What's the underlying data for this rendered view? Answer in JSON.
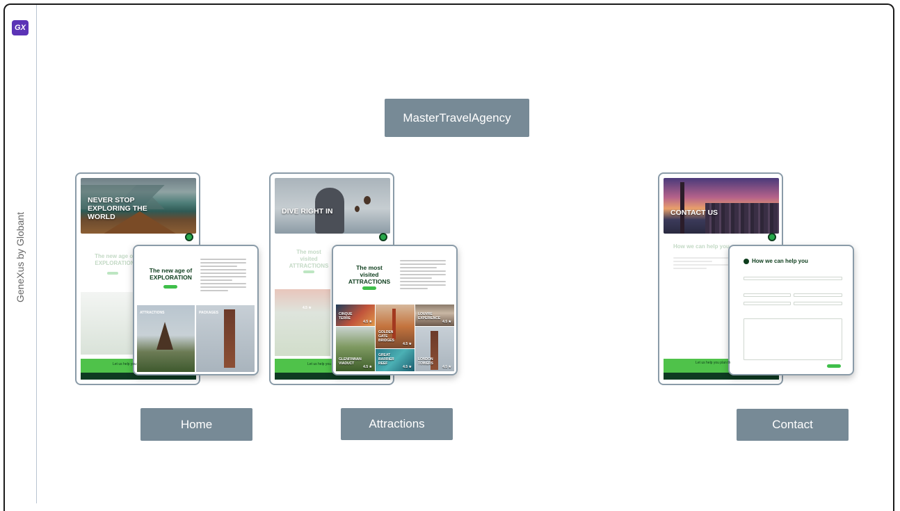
{
  "brand": {
    "logo_text": "GX",
    "vertical_text": "GeneXus by Globant"
  },
  "root": {
    "label": "MasterTravelAgency"
  },
  "pages": [
    {
      "label": "Home",
      "hero_title": "NEVER STOP EXPLORING THE WORLD",
      "faded_heading": "The new age of EXPLORATION",
      "phone_heading_line1": "The new age of",
      "phone_heading_line2": "EXPLORATION",
      "tile1_title": "ATTRACTIONS",
      "tile2_title": "PACKAGES",
      "cta": "Let us help you"
    },
    {
      "label": "Attractions",
      "hero_title": "DIVE RIGHT IN",
      "faded_heading": "The most visited ATTRACTIONS",
      "phone_heading_line1": "The most",
      "phone_heading_line2": "visited",
      "phone_heading_line3": "ATTRACTIONS",
      "tiles": [
        {
          "name": "CINQUE TERRE",
          "rating": "4.5 ★"
        },
        {
          "name": "GOLDEN GATE BRIDGES",
          "rating": "4.5 ★"
        },
        {
          "name": "LOUVRE EXPERIENCE",
          "rating": "4.5 ★"
        },
        {
          "name": "GLENFINNAN VIADUCT",
          "rating": "4.5 ★"
        },
        {
          "name": "GREAT BARRIER REEF",
          "rating": "4.5 ★"
        },
        {
          "name": "LONDON TOWERS",
          "rating": "4.5 ★"
        }
      ],
      "faded_rating": "4.5 ★",
      "cta": "Let us help you"
    },
    {
      "label": "Contact",
      "hero_title": "CONTACT US",
      "faded_heading": "How we can help you",
      "phone_heading": "How we can help you",
      "cta": "Let us help you plan th"
    }
  ]
}
